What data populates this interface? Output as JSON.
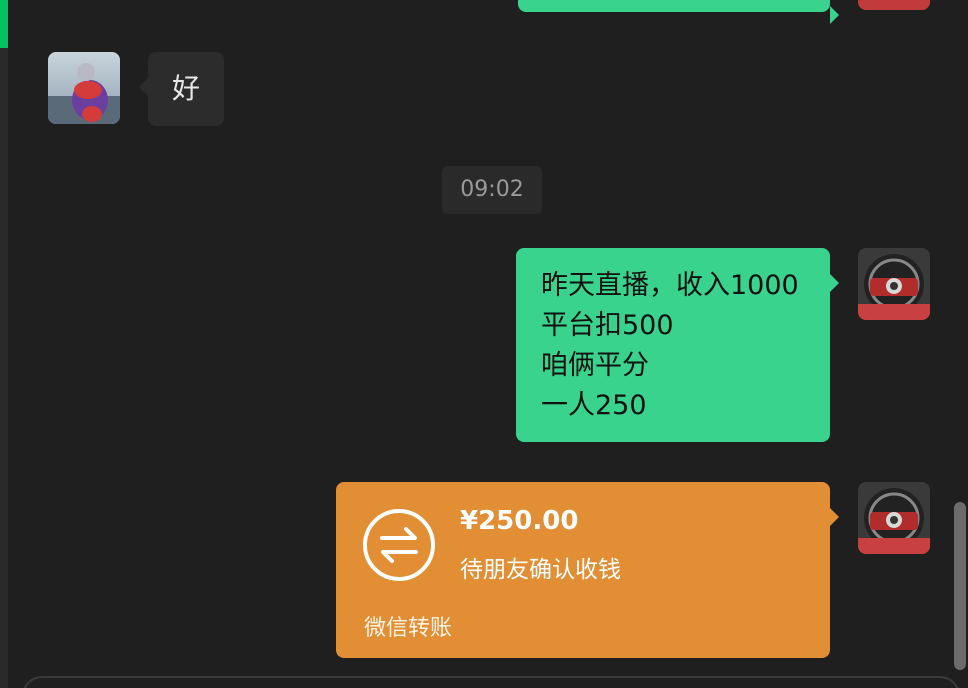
{
  "chat": {
    "incoming": {
      "text": "好"
    },
    "timestamp": "09:02",
    "outgoing_text": {
      "lines": [
        "昨天直播，收入1000",
        "平台扣500",
        "咱俩平分",
        "一人250"
      ]
    },
    "transfer": {
      "amount": "¥250.00",
      "status": "待朋友确认收钱",
      "footer": "微信转账"
    }
  },
  "colors": {
    "background": "#1f1f1f",
    "incoming_bubble": "#2c2c2c",
    "outgoing_bubble": "#39d38d",
    "transfer_card": "#e18e35",
    "accent": "#07c160"
  },
  "icons": {
    "contact_avatar": "contact-avatar",
    "self_avatar": "steering-wheel-avatar",
    "transfer": "transfer-arrows-icon"
  }
}
